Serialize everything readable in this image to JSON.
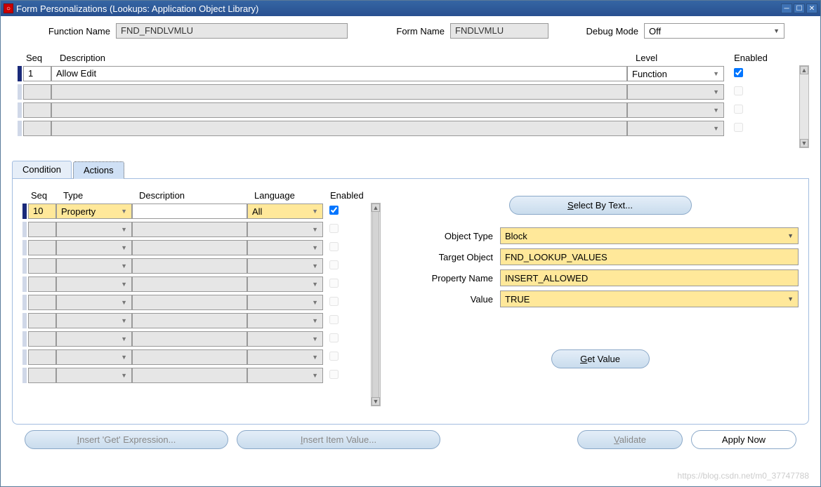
{
  "window": {
    "title": "Form Personalizations (Lookups: Application Object Library)"
  },
  "header": {
    "function_name_label": "Function Name",
    "function_name_value": "FND_FNDLVMLU",
    "form_name_label": "Form Name",
    "form_name_value": "FNDLVMLU",
    "debug_mode_label": "Debug Mode",
    "debug_mode_value": "Off"
  },
  "columns": {
    "seq": "Seq",
    "description": "Description",
    "level": "Level",
    "enabled": "Enabled"
  },
  "rules": [
    {
      "seq": "1",
      "description": "Allow Edit",
      "level": "Function",
      "enabled": true
    }
  ],
  "tabs": {
    "condition": "Condition",
    "actions": "Actions"
  },
  "actions_columns": {
    "seq": "Seq",
    "type": "Type",
    "description": "Description",
    "language": "Language",
    "enabled": "Enabled"
  },
  "actions_rows": [
    {
      "seq": "10",
      "type": "Property",
      "description": "",
      "language": "All",
      "enabled": true
    }
  ],
  "property_panel": {
    "select_by_text": "Select By Text...",
    "object_type_label": "Object Type",
    "object_type_value": "Block",
    "target_object_label": "Target Object",
    "target_object_value": "FND_LOOKUP_VALUES",
    "property_name_label": "Property Name",
    "property_name_value": "INSERT_ALLOWED",
    "value_label": "Value",
    "value_value": "TRUE",
    "get_value": "Get Value"
  },
  "buttons": {
    "insert_get": "Insert 'Get' Expression...",
    "insert_item": "Insert Item Value...",
    "validate": "Validate",
    "apply_now": "Apply Now"
  },
  "watermark": "https://blog.csdn.net/m0_37747788"
}
